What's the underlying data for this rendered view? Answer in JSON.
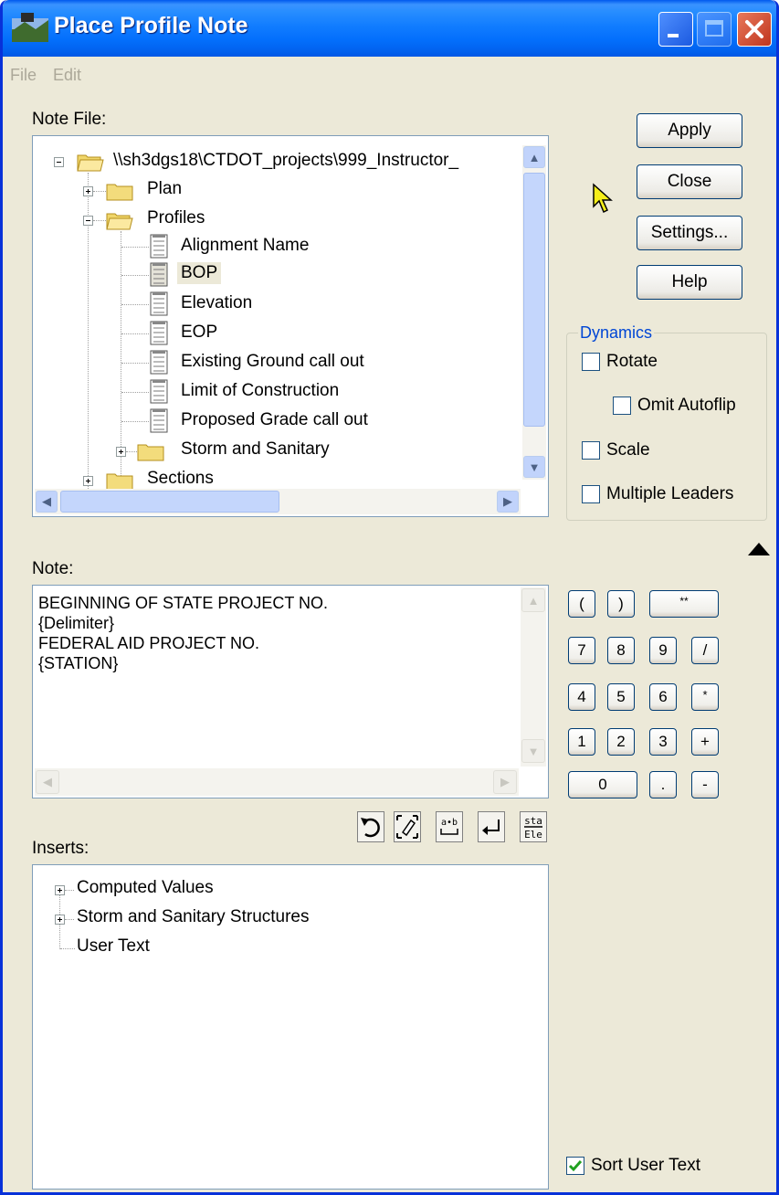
{
  "window": {
    "title": "Place Profile Note"
  },
  "menu": {
    "file": "File",
    "edit": "Edit"
  },
  "note_file": {
    "label": "Note File:",
    "tree": {
      "root": "\\\\sh3dgs18\\CTDOT_projects\\999_Instructor_",
      "plan": "Plan",
      "profiles": "Profiles",
      "profile_items": [
        "Alignment Name",
        "BOP",
        "Elevation",
        "EOP",
        "Existing Ground call out",
        "Limit of Construction",
        "Proposed Grade call out"
      ],
      "storm": "Storm and Sanitary",
      "sections": "Sections"
    }
  },
  "buttons": {
    "apply": "Apply",
    "close": "Close",
    "settings": "Settings...",
    "help": "Help"
  },
  "dynamics": {
    "label": "Dynamics",
    "rotate": "Rotate",
    "omit_autoflip": "Omit Autoflip",
    "scale": "Scale",
    "multiple_leaders": "Multiple Leaders"
  },
  "note": {
    "label": "Note:",
    "lines": [
      "BEGINNING OF STATE PROJECT NO.",
      "{Delimiter}",
      "FEDERAL AID PROJECT NO.",
      "{STATION}"
    ]
  },
  "keypad": {
    "row1": [
      "(",
      ")",
      "**"
    ],
    "row2": [
      "7",
      "8",
      "9",
      "/"
    ],
    "row3": [
      "4",
      "5",
      "6",
      "*"
    ],
    "row4": [
      "1",
      "2",
      "3",
      "+"
    ],
    "row5": [
      "0",
      ".",
      "-"
    ]
  },
  "toolbar": {
    "sta_ele_top": "sta",
    "sta_ele_bottom": "Ele",
    "swap_label": "a•b"
  },
  "inserts": {
    "label": "Inserts:",
    "items": [
      "Computed Values",
      "Storm and Sanitary Structures",
      "User Text"
    ]
  },
  "sort_user_text": {
    "label": "Sort User Text",
    "checked": true
  },
  "colors": {
    "titlebar": "#0a5ce8",
    "dynamics_label": "#0046d5",
    "window_bg": "#ece9d8"
  }
}
